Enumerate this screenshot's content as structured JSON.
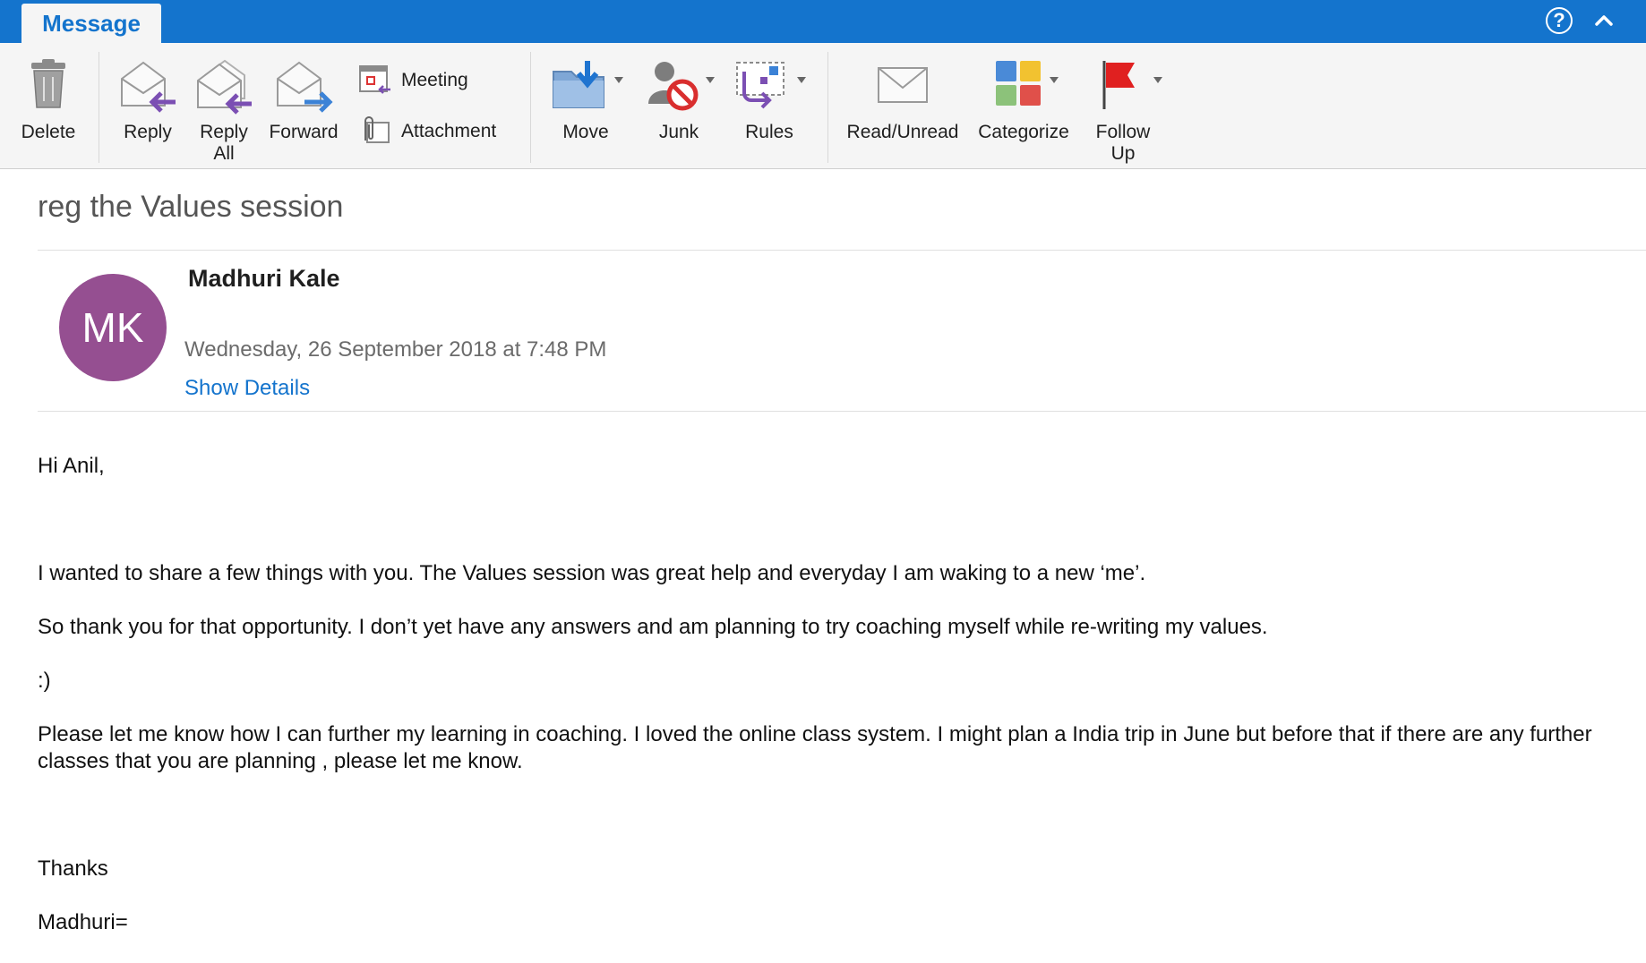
{
  "tabs": {
    "message": "Message"
  },
  "window_controls": {
    "help": "?"
  },
  "ribbon": {
    "delete": "Delete",
    "reply": "Reply",
    "reply_all_1": "Reply",
    "reply_all_2": "All",
    "forward": "Forward",
    "meeting": "Meeting",
    "attachment": "Attachment",
    "move": "Move",
    "junk": "Junk",
    "rules": "Rules",
    "read_unread": "Read/Unread",
    "categorize": "Categorize",
    "follow_up_1": "Follow",
    "follow_up_2": "Up"
  },
  "message": {
    "subject": "reg the Values session",
    "sender_initials": "MK",
    "sender_name": "Madhuri Kale",
    "date": "Wednesday, 26 September 2018 at 7:48 PM",
    "show_details": "Show Details",
    "avatar_color": "#954f91",
    "body": {
      "greeting": "Hi Anil,",
      "line1": "I wanted to share a few things with you. The Values session was great help and everyday I am waking to a new ‘me’.",
      "line2": "So thank you for that opportunity. I don’t yet have any answers and am planning to try coaching myself while re-writing my values.",
      "line3": ":)",
      "line4": "Please let me know how I can further my learning in coaching. I loved the online class system. I might plan a India trip in June but before that if there are any further classes that you are planning , please let me know.",
      "thanks": "Thanks",
      "signature": "Madhuri="
    }
  },
  "colors": {
    "accent": "#1474cd",
    "ribbon_bg": "#f5f5f5"
  }
}
